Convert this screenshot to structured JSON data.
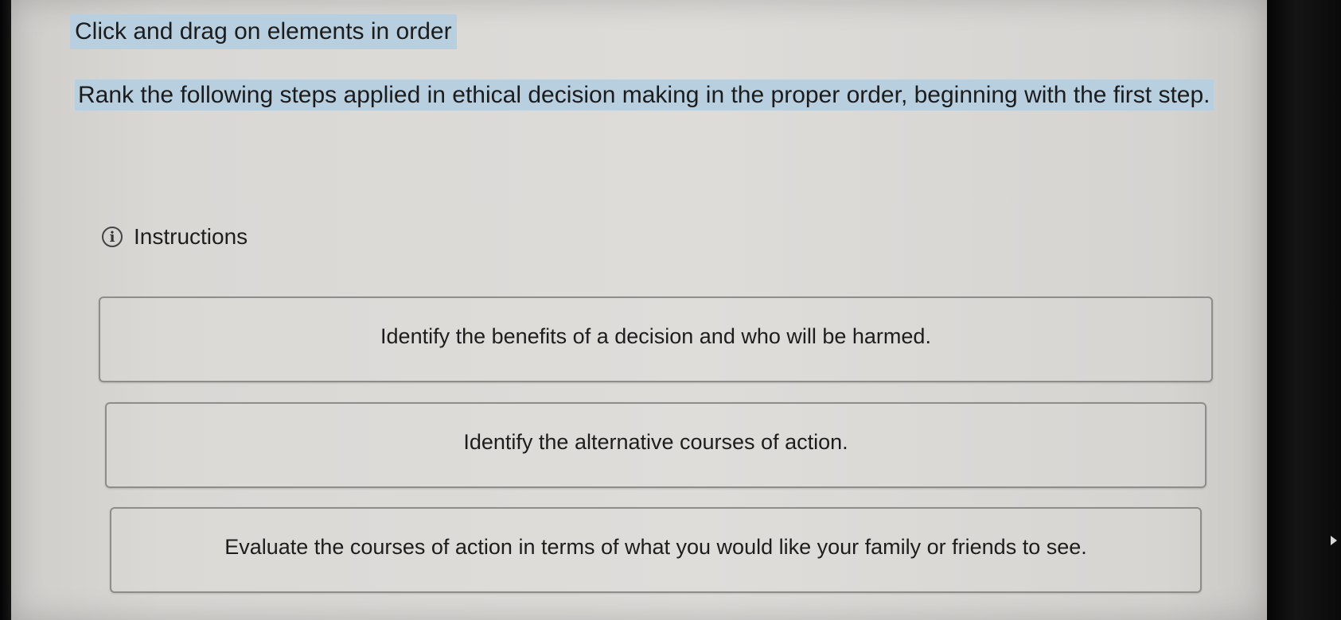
{
  "header": {
    "title": "Click and drag on elements in order"
  },
  "question": {
    "text": "Rank the following steps applied in ethical decision making in the proper order, beginning with the first step."
  },
  "instructions": {
    "label": "Instructions",
    "icon": "info-icon",
    "icon_glyph": "i"
  },
  "items": [
    {
      "label": "Identify the benefits of a decision and who will be harmed."
    },
    {
      "label": "Identify the alternative courses of action."
    },
    {
      "label": "Evaluate the courses of action in terms of what you would like your family or friends to see."
    }
  ],
  "colors": {
    "highlight": "#b8cfe0",
    "screen_background": "#dcdad7",
    "item_border": "#8f8d8a"
  }
}
